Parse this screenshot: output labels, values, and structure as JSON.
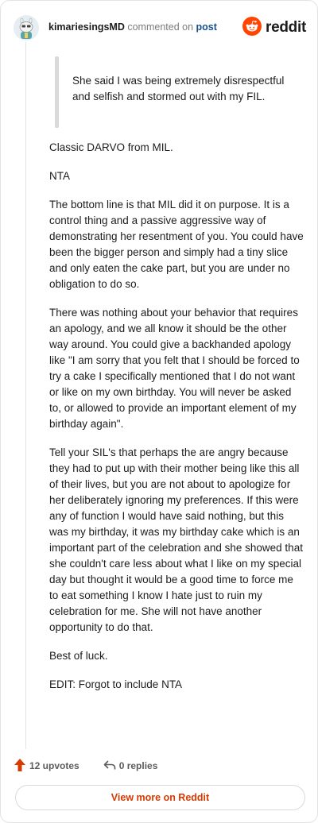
{
  "header": {
    "username": "kimariesingsMD",
    "commented_on": "commented on",
    "post_link": "post",
    "brand": "reddit"
  },
  "quote": "She said I was being extremely disrespectful and selfish and stormed out with my FIL.",
  "paragraphs": [
    "Classic DARVO from MIL.",
    "NTA",
    "The bottom line is that MIL did it on purpose. It is a control thing and a passive aggressive way of demonstrating her resentment of you. You could have been the bigger person and simply had a tiny slice and only eaten the cake part, but you are under no obligation to do so.",
    "There was nothing about your behavior that requires an apology, and we all know it should be the other way around. You could give a backhanded apology like \"I am sorry that you felt that I should be forced to try a cake I specifically mentioned that I do not want or like on my own birthday. You will never be asked to, or allowed to provide an important element of my birthday again\".",
    "Tell your SIL's that perhaps the are angry because they had to put up with their mother being like this all of their lives, but you are not about to apologize for her deliberately ignoring my preferences. If this were any of function I would have said nothing, but this was my birthday, it was my birthday cake which is an important part of the celebration and she showed that she couldn't care less about what I like on my special day but thought it would be a good time to force me to eat something I know I hate just to ruin my celebration for me. She will not have another opportunity to do that.",
    "Best of luck.",
    "EDIT: Forgot to include NTA"
  ],
  "actions": {
    "upvotes": "12 upvotes",
    "replies": "0 replies"
  },
  "view_more": "View more on Reddit",
  "colors": {
    "reddit_orange": "#ff4500",
    "link_blue": "#1a4f8a",
    "view_more_text": "#d93a00"
  },
  "icons": [
    "avatar",
    "reddit-logo-icon",
    "upvote-arrow-icon",
    "reply-icon"
  ]
}
